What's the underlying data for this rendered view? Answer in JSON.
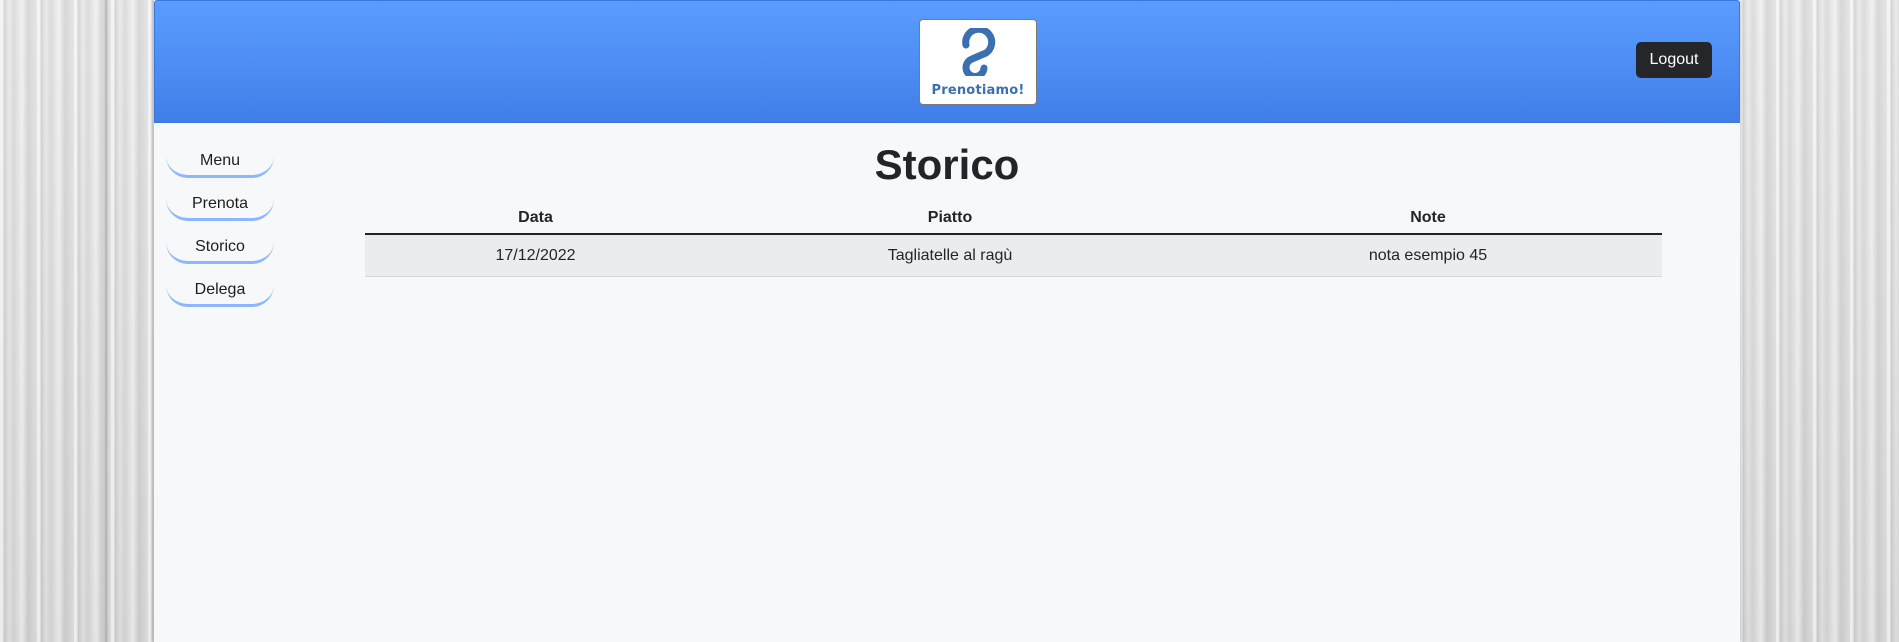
{
  "header": {
    "logo_text": "Prenotiamo!",
    "logout_label": "Logout"
  },
  "sidebar": {
    "items": [
      {
        "label": "Menu"
      },
      {
        "label": "Prenota"
      },
      {
        "label": "Storico"
      },
      {
        "label": "Delega"
      }
    ]
  },
  "main": {
    "title": "Storico",
    "table": {
      "columns": [
        "Data",
        "Piatto",
        "Note"
      ],
      "rows": [
        {
          "data": "17/12/2022",
          "piatto": "Tagliatelle al ragù",
          "note": "nota esempio 45"
        }
      ]
    }
  },
  "colors": {
    "header_blue": "#4d8df3",
    "logout_bg": "#24262a",
    "nav_underline": "#8cb7ff",
    "logo_blue": "#3a6fb0"
  }
}
